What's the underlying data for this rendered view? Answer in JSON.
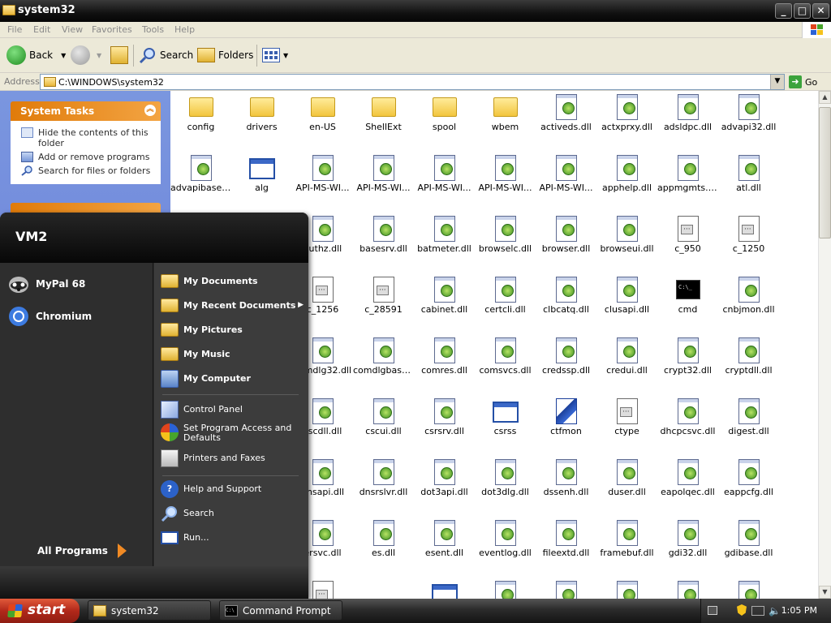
{
  "window": {
    "title": "system32",
    "buttons": {
      "minimize": "_",
      "maximize": "□",
      "close": "✕"
    }
  },
  "menu": [
    "File",
    "Edit",
    "View",
    "Favorites",
    "Tools",
    "Help"
  ],
  "toolbar": {
    "back": "Back",
    "search": "Search",
    "folders": "Folders"
  },
  "address": {
    "label": "Address",
    "value": "C:\\WINDOWS\\system32",
    "go": "Go"
  },
  "left_pane": {
    "system_tasks": {
      "title": "System Tasks",
      "items": [
        "Hide the contents of this folder",
        "Add or remove programs",
        "Search for files or folders"
      ]
    }
  },
  "files": [
    {
      "name": "config",
      "type": "folder"
    },
    {
      "name": "drivers",
      "type": "folder"
    },
    {
      "name": "en-US",
      "type": "folder"
    },
    {
      "name": "ShellExt",
      "type": "folder"
    },
    {
      "name": "spool",
      "type": "folder"
    },
    {
      "name": "wbem",
      "type": "folder"
    },
    {
      "name": "activeds.dll",
      "type": "dll"
    },
    {
      "name": "actxprxy.dll",
      "type": "dll"
    },
    {
      "name": "adsldpc.dll",
      "type": "dll"
    },
    {
      "name": "advapi32.dll",
      "type": "dll"
    },
    {
      "name": "advapibase.dll",
      "type": "dll"
    },
    {
      "name": "alg",
      "type": "exe"
    },
    {
      "name": "API-MS-WI...",
      "type": "dll"
    },
    {
      "name": "API-MS-WI...",
      "type": "dll"
    },
    {
      "name": "API-MS-WI...",
      "type": "dll"
    },
    {
      "name": "API-MS-WI...",
      "type": "dll"
    },
    {
      "name": "API-MS-WI...",
      "type": "dll"
    },
    {
      "name": "apphelp.dll",
      "type": "dll"
    },
    {
      "name": "appmgmts.dll",
      "type": "dll"
    },
    {
      "name": "atl.dll",
      "type": "dll"
    },
    {
      "name": "",
      "type": "hidden"
    },
    {
      "name": "",
      "type": "hidden"
    },
    {
      "name": "authz.dll",
      "type": "dll"
    },
    {
      "name": "basesrv.dll",
      "type": "dll"
    },
    {
      "name": "batmeter.dll",
      "type": "dll"
    },
    {
      "name": "browselc.dll",
      "type": "dll"
    },
    {
      "name": "browser.dll",
      "type": "dll"
    },
    {
      "name": "browseui.dll",
      "type": "dll"
    },
    {
      "name": "c_950",
      "type": "nls"
    },
    {
      "name": "c_1250",
      "type": "nls"
    },
    {
      "name": "",
      "type": "hidden"
    },
    {
      "name": "",
      "type": "hidden"
    },
    {
      "name": "c_1256",
      "type": "nls"
    },
    {
      "name": "c_28591",
      "type": "nls"
    },
    {
      "name": "cabinet.dll",
      "type": "dll"
    },
    {
      "name": "certcli.dll",
      "type": "dll"
    },
    {
      "name": "clbcatq.dll",
      "type": "dll"
    },
    {
      "name": "clusapi.dll",
      "type": "dll"
    },
    {
      "name": "cmd",
      "type": "cmd"
    },
    {
      "name": "cnbjmon.dll",
      "type": "dll"
    },
    {
      "name": "",
      "type": "hidden"
    },
    {
      "name": "",
      "type": "hidden"
    },
    {
      "name": "comdlg32.dll",
      "type": "dll"
    },
    {
      "name": "comdlgbase.dll",
      "type": "dll"
    },
    {
      "name": "comres.dll",
      "type": "dll"
    },
    {
      "name": "comsvcs.dll",
      "type": "dll"
    },
    {
      "name": "credssp.dll",
      "type": "dll"
    },
    {
      "name": "credui.dll",
      "type": "dll"
    },
    {
      "name": "crypt32.dll",
      "type": "dll"
    },
    {
      "name": "cryptdll.dll",
      "type": "dll"
    },
    {
      "name": "",
      "type": "hidden"
    },
    {
      "name": "",
      "type": "hidden"
    },
    {
      "name": "cscdll.dll",
      "type": "dll"
    },
    {
      "name": "cscui.dll",
      "type": "dll"
    },
    {
      "name": "csrsrv.dll",
      "type": "dll"
    },
    {
      "name": "csrss",
      "type": "exe"
    },
    {
      "name": "ctfmon",
      "type": "ctf"
    },
    {
      "name": "ctype",
      "type": "nls"
    },
    {
      "name": "dhcpcsvc.dll",
      "type": "dll"
    },
    {
      "name": "digest.dll",
      "type": "dll"
    },
    {
      "name": "",
      "type": "hidden"
    },
    {
      "name": "",
      "type": "hidden"
    },
    {
      "name": "dnsapi.dll",
      "type": "dll"
    },
    {
      "name": "dnsrslvr.dll",
      "type": "dll"
    },
    {
      "name": "dot3api.dll",
      "type": "dll"
    },
    {
      "name": "dot3dlg.dll",
      "type": "dll"
    },
    {
      "name": "dssenh.dll",
      "type": "dll"
    },
    {
      "name": "duser.dll",
      "type": "dll"
    },
    {
      "name": "eapolqec.dll",
      "type": "dll"
    },
    {
      "name": "eappcfg.dll",
      "type": "dll"
    },
    {
      "name": "",
      "type": "hidden"
    },
    {
      "name": "",
      "type": "hidden"
    },
    {
      "name": "ersvc.dll",
      "type": "dll"
    },
    {
      "name": "es.dll",
      "type": "dll"
    },
    {
      "name": "esent.dll",
      "type": "dll"
    },
    {
      "name": "eventlog.dll",
      "type": "dll"
    },
    {
      "name": "fileextd.dll",
      "type": "dll"
    },
    {
      "name": "framebuf.dll",
      "type": "dll"
    },
    {
      "name": "gdi32.dll",
      "type": "dll"
    },
    {
      "name": "gdibase.dll",
      "type": "dll"
    },
    {
      "name": "",
      "type": "hidden"
    },
    {
      "name": "",
      "type": "hidden"
    },
    {
      "name": "",
      "type": "nls"
    },
    {
      "name": "",
      "type": "hidden"
    },
    {
      "name": "",
      "type": "exe"
    },
    {
      "name": "",
      "type": "dll"
    },
    {
      "name": "",
      "type": "dll"
    },
    {
      "name": "",
      "type": "dll"
    },
    {
      "name": "",
      "type": "dll"
    },
    {
      "name": "",
      "type": "dll"
    }
  ],
  "start_menu": {
    "user": "VM2",
    "pinned": [
      {
        "label": "MyPal 68",
        "icon": "raccoon-icon"
      },
      {
        "label": "Chromium",
        "icon": "chromium-icon"
      }
    ],
    "all_programs": "All Programs",
    "right": {
      "my_documents": "My Documents",
      "my_recent_documents": "My Recent Documents",
      "my_pictures": "My Pictures",
      "my_music": "My Music",
      "my_computer": "My Computer",
      "control_panel": "Control Panel",
      "set_program_access": "Set Program Access and Defaults",
      "printers_and_faxes": "Printers and Faxes",
      "help_and_support": "Help and Support",
      "search": "Search",
      "run": "Run..."
    }
  },
  "taskbar": {
    "start": "start",
    "tasks": [
      {
        "label": "system32"
      },
      {
        "label": "Command Prompt"
      }
    ],
    "clock": "1:05 PM"
  }
}
